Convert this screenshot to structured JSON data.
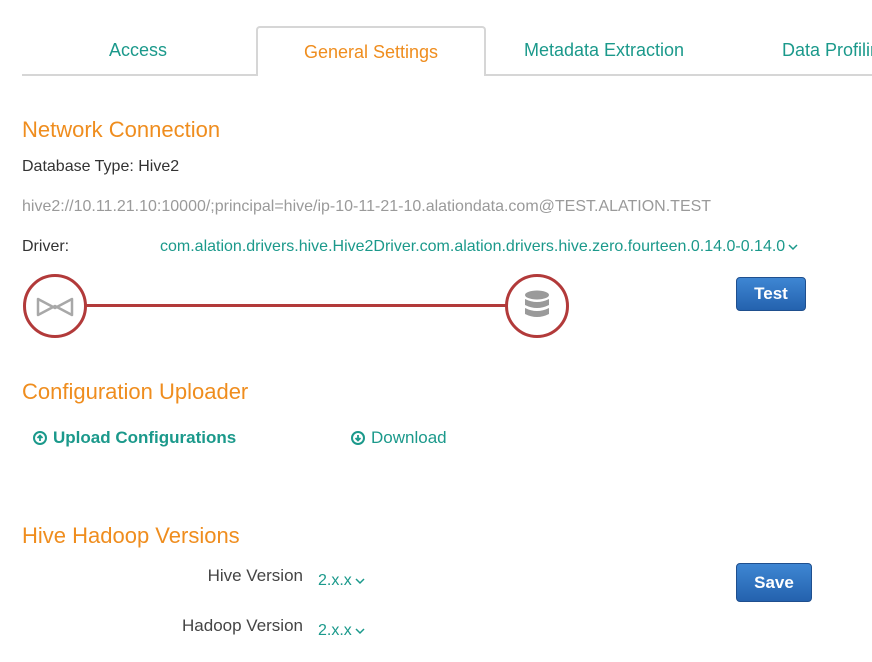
{
  "tabs": [
    {
      "label": "Access"
    },
    {
      "label": "General Settings"
    },
    {
      "label": "Metadata Extraction"
    },
    {
      "label": "Data Profiling"
    }
  ],
  "network": {
    "title": "Network Connection",
    "db_type": "Database Type: Hive2",
    "uri": "hive2://10.11.21.10:10000/;principal=hive/ip-10-11-21-10.alationdata.com@TEST.ALATION.TEST",
    "driver_label": "Driver:",
    "driver_value": "com.alation.drivers.hive.Hive2Driver.com.alation.drivers.hive.zero.fourteen.0.14.0-0.14.0",
    "test_button": "Test",
    "source_icon": "alation-logo-icon",
    "target_icon": "database-icon",
    "line_color": "#b23a3a"
  },
  "config": {
    "title": "Configuration Uploader",
    "upload_label": "Upload Configurations",
    "download_label": "Download"
  },
  "versions": {
    "title": "Hive Hadoop Versions",
    "hive_label": "Hive Version",
    "hive_value": "2.x.x",
    "hadoop_label": "Hadoop Version",
    "hadoop_value": "2.x.x",
    "save_button": "Save"
  },
  "colors": {
    "accent_orange": "#ef8d1e",
    "link_teal": "#1b998b",
    "button_blue": "#2b6cb8"
  }
}
